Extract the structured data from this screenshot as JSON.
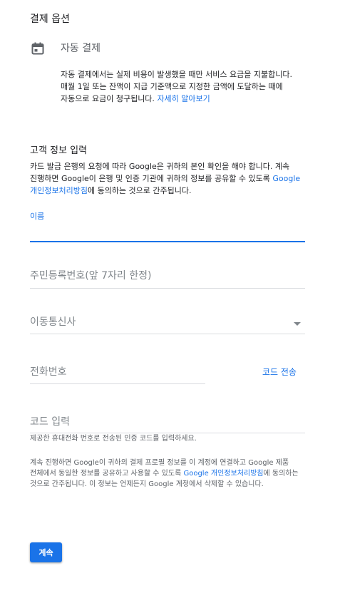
{
  "payment_options": {
    "title": "결제 옵션",
    "autopay_icon": "calendar-icon",
    "autopay_label": "자동 결제",
    "autopay_description": "자동 결제에서는 실제 비용이 발생했을 때만 서비스 요금을 지불합니다. 매월 1일 또는 잔액이 지급 기준액으로 지정한 금액에 도달하는 때에 자동으로 요금이 청구됩니다.",
    "learn_more": "자세히 알아보기"
  },
  "customer_info": {
    "title": "고객 정보 입력",
    "description_before": "카드 발급 은행의 요청에 따라 Google은 귀하의 본인 확인을 해야 합니다. 계속 진행하면 Google이 은행 및 인증 기관에 귀하의 정보를 공유할 수 있도록 ",
    "privacy_link": "Google 개인정보처리방침",
    "description_after": "에 동의하는 것으로 간주됩니다."
  },
  "form": {
    "name_label": "이름",
    "rrn_label": "주민등록번호(앞 7자리 한정)",
    "carrier_label": "이동통신사",
    "phone_label": "전화번호",
    "send_code": "코드 전송",
    "code_label": "코드 입력",
    "code_hint": "제공한 휴대전화 번호로 전송된 인증 코드를 입력하세요."
  },
  "consent": {
    "text_before": "계속 진행하면 Google이 귀하의 결제 프로필 정보를 이 계정에 연결하고 Google 제품 전체에서 동일한 정보를 공유하고 사용할 수 있도록 ",
    "privacy_link": "Google 개인정보처리방침",
    "text_after": "에 동의하는 것으로 간주됩니다. 이 정보는 언제든지 Google 계정에서 삭제할 수 있습니다."
  },
  "actions": {
    "continue_label": "계속"
  },
  "colors": {
    "accent": "#1a73e8",
    "text": "#202124",
    "muted": "#80868b",
    "divider": "#dadce0"
  }
}
